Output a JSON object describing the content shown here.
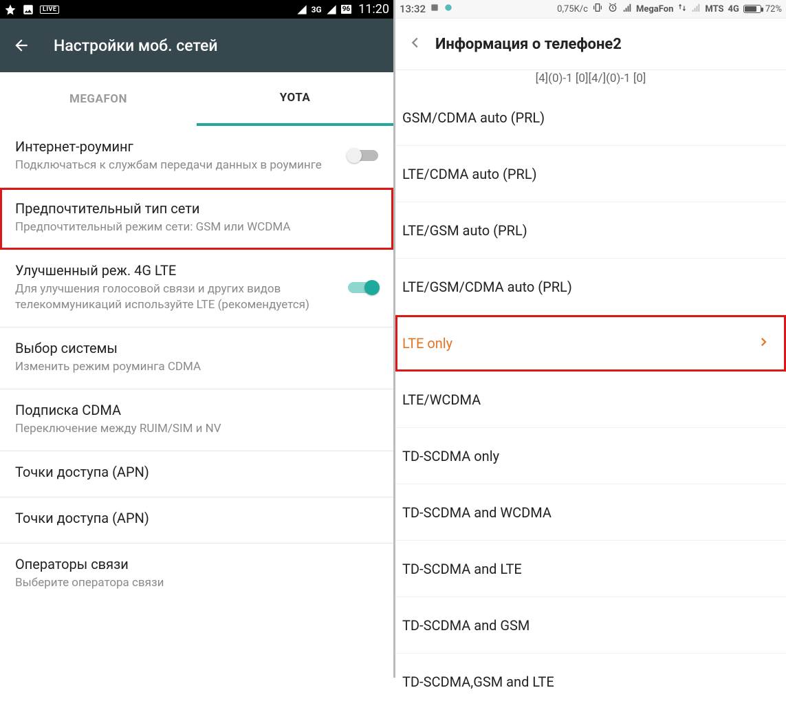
{
  "left": {
    "status": {
      "live_label": "LIVE",
      "net_badge": "3G",
      "batt_badge": "96",
      "time": "11:20"
    },
    "header_title": "Настройки моб. сетей",
    "tabs": {
      "megafon": "MEGAFON",
      "yota": "YOTA"
    },
    "rows": {
      "roaming": {
        "title": "Интернет-роуминг",
        "subtitle": "Подключаться к службам передачи данных в роуминге"
      },
      "net_type": {
        "title": "Предпочтительный тип сети",
        "subtitle": "Предпочтительный режим сети: GSM или WCDMA"
      },
      "enhanced": {
        "title": "Улучшенный реж. 4G LTE",
        "subtitle": "Для улучшения голосовой связи и других видов телекоммуникаций используйте LTE (рекомендуется)"
      },
      "system": {
        "title": "Выбор системы",
        "subtitle": "Изменить режим роуминга CDMA"
      },
      "cdma_sub": {
        "title": "Подписка CDMA",
        "subtitle": "Переключение между RUIM/SIM и NV"
      },
      "apn1": {
        "title": "Точки доступа (APN)"
      },
      "apn2": {
        "title": "Точки доступа (APN)"
      },
      "operators": {
        "title": "Операторы связи",
        "subtitle": "Выберите оператора связи"
      }
    }
  },
  "right": {
    "status": {
      "time": "13:32",
      "speed": "0,75K/c",
      "carrier1": "MegaFon",
      "carrier2": "MTS",
      "net_type": "4G",
      "batt_pct": "72%"
    },
    "header_title": "Информация о телефоне2",
    "partial_top": "[4](0)-1 [0][4/](0)-1 [0]",
    "items": [
      "GSM/CDMA auto (PRL)",
      "LTE/CDMA auto (PRL)",
      "LTE/GSM auto (PRL)",
      "LTE/GSM/CDMA auto (PRL)",
      "LTE only",
      "LTE/WCDMA",
      "TD-SCDMA only",
      "TD-SCDMA and WCDMA",
      "TD-SCDMA and LTE",
      "TD-SCDMA and GSM",
      "TD-SCDMA,GSM and LTE"
    ]
  }
}
